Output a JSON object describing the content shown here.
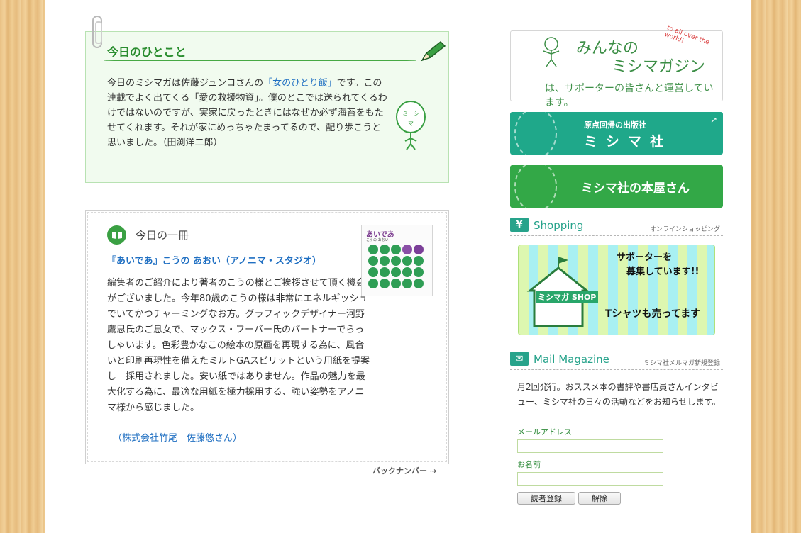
{
  "hitokoto": {
    "title": "今日のひとこと",
    "text_before_link": "今日のミシマガは佐藤ジュンコさんの",
    "link": "「女のひとり飯」",
    "text_after_link": "です。この連載でよく出てくる「愛の救援物資」。僕のとこでは送られてくるわけではないのですが、実家に戻ったときにはなぜか必ず海苔をもたせてくれます。それが家にめっちゃたまってるので、配り歩こうと思いました。（田渕洋二郎）",
    "mascot_face": "ミシマ"
  },
  "book": {
    "heading": "今日の一冊",
    "title": "『あいであ』こうの あおい（アノニマ・スタジオ）",
    "body": "編集者のご紹介により著者のこうの様とご挨拶させて頂く機会がございました。今年80歳のこうの様は非常にエネルギッシュでいてかつチャーミングなお方。グラフィックデザイナー河野鷹思氏のご息女で、マックス・フーバー氏のパートナーでらっしゃいます。色彩豊かなこの絵本の原画を再現する為に、風合いと印刷再現性を備えたミルトGAスピリットという用紙を提案し　採用されました。安い紙ではありません。作品の魅力を最大化する為に、最適な用紙を極力採用する、強い姿勢をアノニマ様から感じました。",
    "credit": "（株式会社竹尾　佐藤悠さん）",
    "cover_title": "あいであ",
    "cover_author": "こうの あおい"
  },
  "back_number": "バックナンバー",
  "banners": {
    "minna_line1": "みんなの",
    "minna_line2": "ミシマガジン",
    "minna_line3": "は、サポーターの皆さんと運営しています。",
    "minna_tag": "to all over the world!",
    "mishimasha_small": "原点回帰の出版社",
    "mishimasha_big": "ミシマ社",
    "honya": "ミシマ社の本屋さん",
    "shop_text1": "サポーターを",
    "shop_text2": "募集しています!!",
    "shop_text3": "Tシャツも売ってます",
    "shop_label": "ミシマガ SHOP"
  },
  "shopping": {
    "title": "Shopping",
    "sub": "オンラインショッピング"
  },
  "mail": {
    "title": "Mail Magazine",
    "sub": "ミシマ社メルマガ新規登録",
    "desc": "月2回発行。おススメ本の書評や書店員さんインタビュー、ミシマ社の日々の活動などをお知らせします。",
    "email_label": "メールアドレス",
    "name_label": "お名前",
    "register_button": "読者登録",
    "unregister_button": "解除"
  },
  "colors": {
    "green": "#33a847",
    "teal": "#1fa88a",
    "link_blue": "#1f6fc2"
  }
}
